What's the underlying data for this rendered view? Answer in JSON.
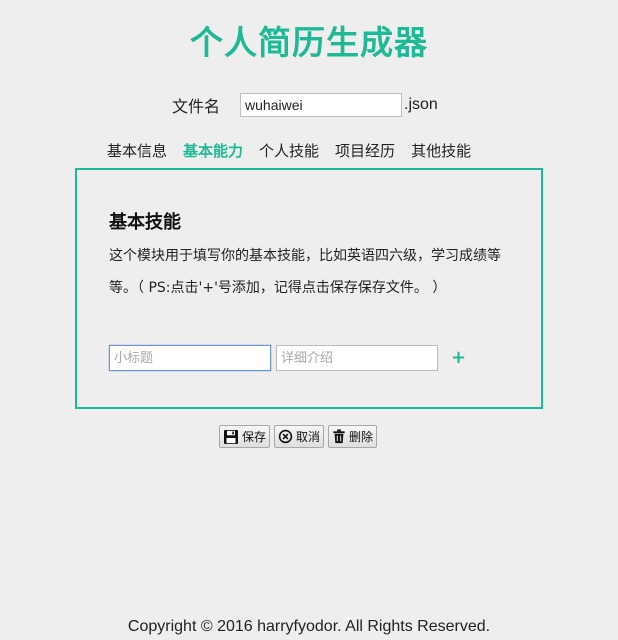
{
  "app": {
    "title": "个人简历生成器"
  },
  "filename": {
    "label": "文件名",
    "value": "wuhaiwei",
    "extension": ".json"
  },
  "tabs": [
    {
      "label": "基本信息",
      "active": false
    },
    {
      "label": "基本能力",
      "active": true
    },
    {
      "label": "个人技能",
      "active": false
    },
    {
      "label": "项目经历",
      "active": false
    },
    {
      "label": "其他技能",
      "active": false
    }
  ],
  "panel": {
    "heading": "基本技能",
    "description": "这个模块用于填写你的基本技能，比如英语四六级，学习成绩等等。（ PS:点击'+'号添加，记得点击保存保存文件。 ）",
    "title_placeholder": "小标题",
    "detail_placeholder": "详细介绍",
    "add_label": "+"
  },
  "actions": {
    "save_label": "保存",
    "cancel_label": "取消",
    "delete_label": "删除",
    "save_icon": "floppy-disk-icon",
    "cancel_icon": "circle-x-icon",
    "delete_icon": "trash-icon"
  },
  "footer": {
    "copyright": "Copyright © 2016 harryfyodor. All Rights Reserved."
  },
  "colors": {
    "accent": "#1fb997",
    "background": "#eeeeee",
    "focus_border": "#6b95d6"
  }
}
